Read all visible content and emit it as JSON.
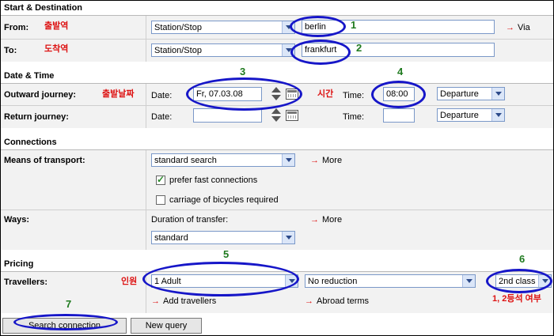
{
  "sections": {
    "start_destination": "Start & Destination",
    "date_time": "Date & Time",
    "connections": "Connections",
    "pricing": "Pricing"
  },
  "from": {
    "label": "From:",
    "annotation": "출발역",
    "type": "Station/Stop",
    "value": "berlin",
    "callout": "1",
    "via": "Via"
  },
  "to": {
    "label": "To:",
    "annotation": "도착역",
    "type": "Station/Stop",
    "value": "frankfurt",
    "callout": "2"
  },
  "outward": {
    "label": "Outward journey:",
    "annotation_date": "출발날짜",
    "date_label": "Date:",
    "date_value": "Fr, 07.03.08",
    "callout_date": "3",
    "annotation_time": "시간",
    "time_label": "Time:",
    "time_value": "08:00",
    "callout_time": "4",
    "mode": "Departure"
  },
  "return": {
    "label": "Return journey:",
    "date_label": "Date:",
    "date_value": "",
    "time_label": "Time:",
    "time_value": "",
    "mode": "Departure"
  },
  "connections": {
    "means_label": "Means of transport:",
    "means_value": "standard search",
    "more": "More",
    "prefer_fast": "prefer fast connections",
    "prefer_fast_checked": true,
    "bicycles": "carriage of bicycles required",
    "bicycles_checked": false,
    "ways_label": "Ways:",
    "transfer_label": "Duration of transfer:",
    "transfer_value": "standard",
    "ways_more": "More"
  },
  "pricing": {
    "travellers_label": "Travellers:",
    "annotation_people": "인원",
    "callout_travellers": "5",
    "travellers_value": "1 Adult",
    "reduction_value": "No reduction",
    "callout_class": "6",
    "class_value": "2nd class",
    "annotation_class": "1, 2등석 여부",
    "add_travellers": "Add travellers",
    "abroad_terms": "Abroad terms"
  },
  "buttons": {
    "search": "Search connection",
    "new_query": "New query",
    "callout_search": "7"
  },
  "colors": {
    "annotation_red": "#d11111",
    "callout_green": "#1f7a1f",
    "oval_blue": "#1616c8"
  }
}
